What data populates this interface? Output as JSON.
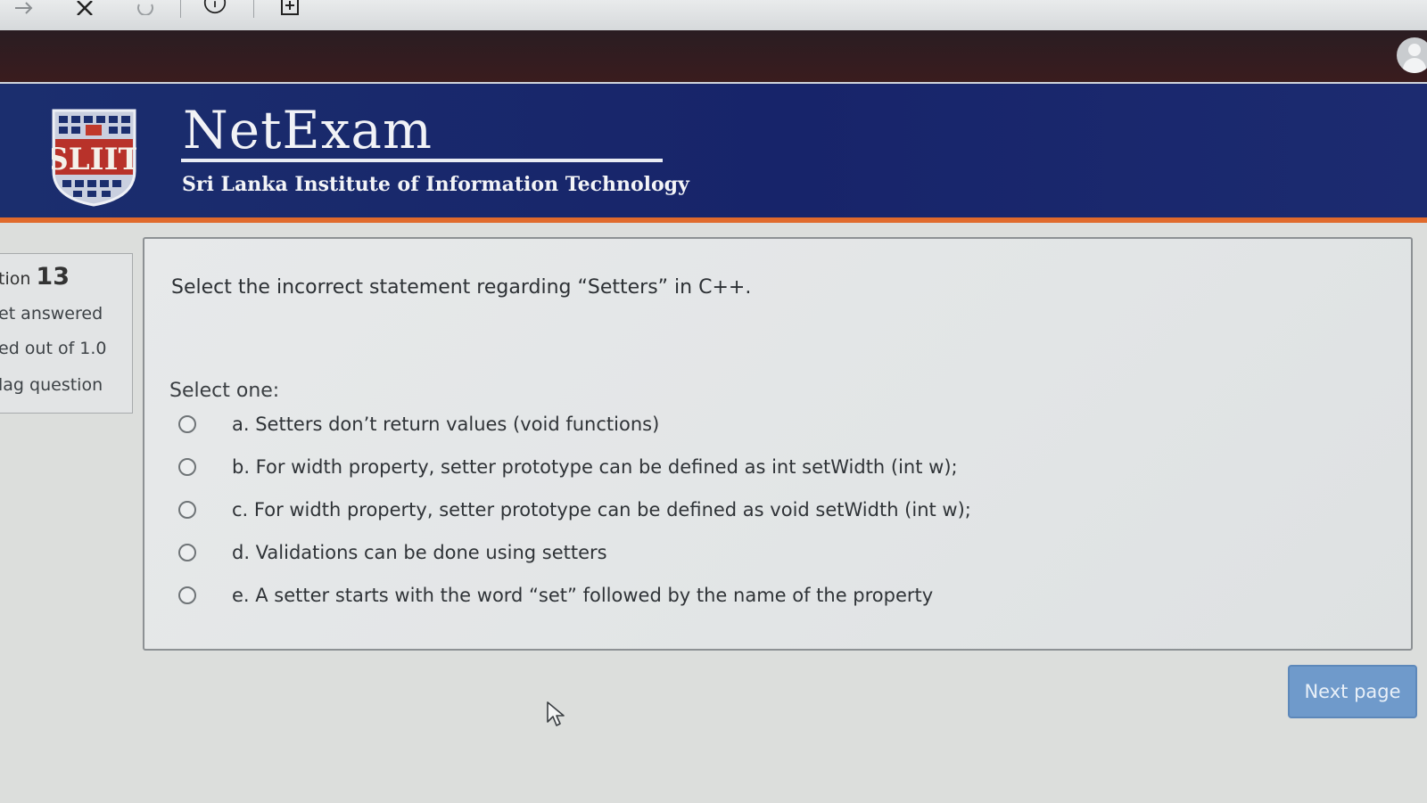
{
  "header": {
    "app_title": "NetExam",
    "institute": "Sri Lanka Institute of Information Technology",
    "logo_text": "SLIIT"
  },
  "colors": {
    "banner": "#1b2e6e",
    "banner_accent": "#e06a2c",
    "top_nav": "#2a1d22",
    "next_button": "#6f9acb"
  },
  "question_info": {
    "label": "tion",
    "number": "13",
    "status": "et answered",
    "marks": "ed out of 1.0",
    "flag": "lag question"
  },
  "question": {
    "text": "Select the incorrect statement regarding “Setters” in C++.",
    "prompt": "Select one:",
    "options": [
      {
        "label": "a. Setters don’t return values (void functions)"
      },
      {
        "label": "b. For width property, setter prototype can be defined as int setWidth (int w);"
      },
      {
        "label": "c. For width property, setter prototype can be defined as void setWidth (int w);"
      },
      {
        "label": "d. Validations can be done using setters"
      },
      {
        "label": "e. A setter starts with the word “set” followed by the name of the property"
      }
    ]
  },
  "navigation": {
    "next_label": "Next page"
  }
}
